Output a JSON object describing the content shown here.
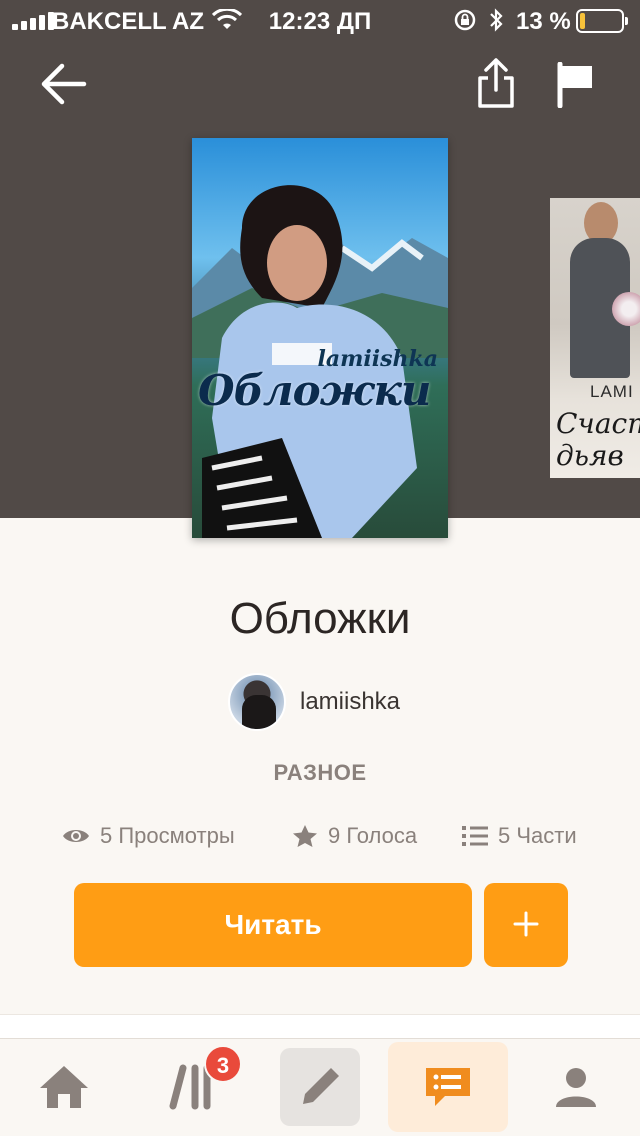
{
  "status_bar": {
    "carrier": "BAKCELL AZ",
    "time": "12:23 ДП",
    "battery_percent": "13 %",
    "battery_level": 0.13
  },
  "story": {
    "title": "Обложки",
    "author": "lamiishka",
    "category": "РАЗНОЕ",
    "cover_author": "lamiishka",
    "cover_title": "Обложки",
    "stats": {
      "views": "5 Просмотры",
      "votes": "9 Голоса",
      "parts": "5 Части"
    }
  },
  "next_cover": {
    "author": "LAMI",
    "title_line1": "Счаст",
    "title_line2": "дьяв"
  },
  "actions": {
    "read_label": "Читать",
    "add_label": "+"
  },
  "bottom_nav": {
    "library_badge": "3",
    "items": [
      "home-icon",
      "library-icon",
      "write-icon",
      "chat-icon",
      "profile-icon"
    ]
  },
  "colors": {
    "accent": "#ff9d14",
    "header_bg": "#514a47",
    "badge": "#e94a3b"
  }
}
